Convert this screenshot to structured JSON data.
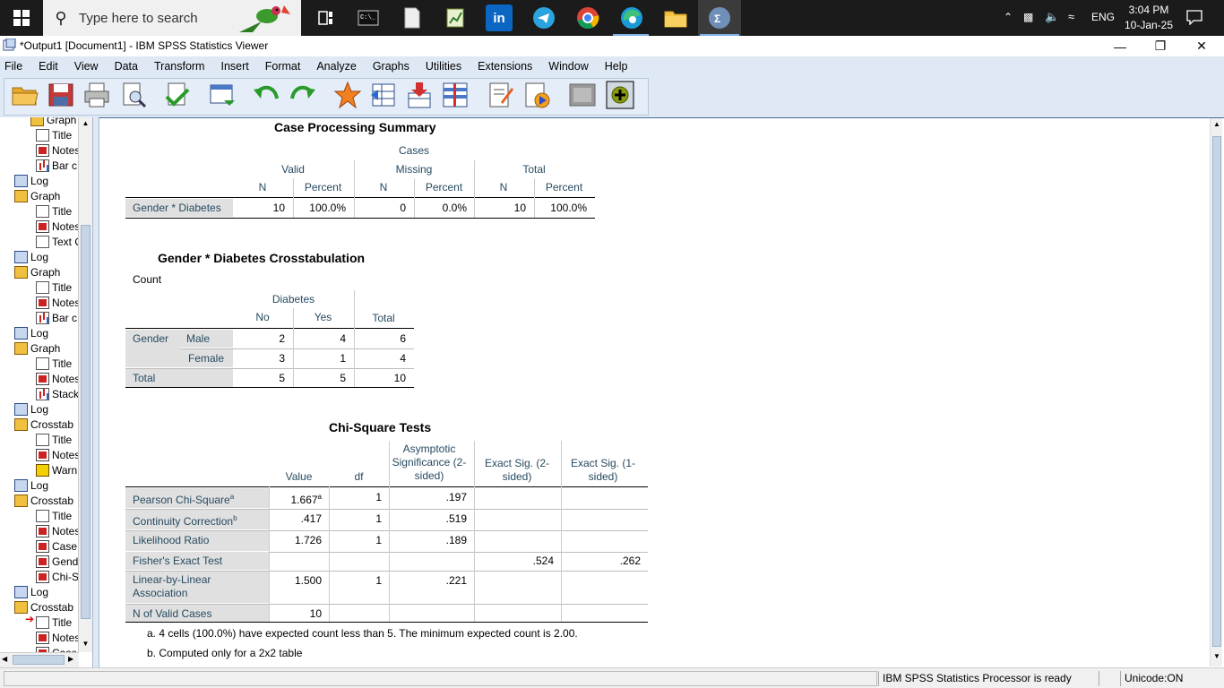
{
  "taskbar": {
    "search_placeholder": "Type here to search",
    "clock_time": "3:04 PM",
    "clock_date": "10-Jan-25",
    "lang": "ENG"
  },
  "window": {
    "title": "*Output1 [Document1] - IBM SPSS Statistics Viewer",
    "minimize": "—",
    "maximize": "❐",
    "close": "✕"
  },
  "menu": [
    "File",
    "Edit",
    "View",
    "Data",
    "Transform",
    "Insert",
    "Format",
    "Analyze",
    "Graphs",
    "Utilities",
    "Extensions",
    "Window",
    "Help"
  ],
  "outline": [
    {
      "indent": 34,
      "icon": "graph",
      "label": "Graph"
    },
    {
      "indent": 40,
      "icon": "title",
      "label": "Title"
    },
    {
      "indent": 40,
      "icon": "note",
      "label": "Notes"
    },
    {
      "indent": 40,
      "icon": "bar",
      "label": "Bar c"
    },
    {
      "indent": 16,
      "icon": "log",
      "label": "Log"
    },
    {
      "indent": 16,
      "icon": "graph",
      "label": "Graph"
    },
    {
      "indent": 40,
      "icon": "title",
      "label": "Title"
    },
    {
      "indent": 40,
      "icon": "note",
      "label": "Notes"
    },
    {
      "indent": 40,
      "icon": "text",
      "label": "Text O"
    },
    {
      "indent": 16,
      "icon": "log",
      "label": "Log"
    },
    {
      "indent": 16,
      "icon": "graph",
      "label": "Graph"
    },
    {
      "indent": 40,
      "icon": "title",
      "label": "Title"
    },
    {
      "indent": 40,
      "icon": "note",
      "label": "Notes"
    },
    {
      "indent": 40,
      "icon": "bar",
      "label": "Bar c"
    },
    {
      "indent": 16,
      "icon": "log",
      "label": "Log"
    },
    {
      "indent": 16,
      "icon": "graph",
      "label": "Graph"
    },
    {
      "indent": 40,
      "icon": "title",
      "label": "Title"
    },
    {
      "indent": 40,
      "icon": "note",
      "label": "Notes"
    },
    {
      "indent": 40,
      "icon": "bar",
      "label": "Stack"
    },
    {
      "indent": 16,
      "icon": "log",
      "label": "Log"
    },
    {
      "indent": 16,
      "icon": "graph",
      "label": "Crosstab"
    },
    {
      "indent": 40,
      "icon": "title",
      "label": "Title"
    },
    {
      "indent": 40,
      "icon": "note",
      "label": "Notes"
    },
    {
      "indent": 40,
      "icon": "warn",
      "label": "Warn"
    },
    {
      "indent": 16,
      "icon": "log",
      "label": "Log"
    },
    {
      "indent": 16,
      "icon": "graph",
      "label": "Crosstab"
    },
    {
      "indent": 40,
      "icon": "title",
      "label": "Title"
    },
    {
      "indent": 40,
      "icon": "note",
      "label": "Notes"
    },
    {
      "indent": 40,
      "icon": "note",
      "label": "Case"
    },
    {
      "indent": 40,
      "icon": "note",
      "label": "Gend"
    },
    {
      "indent": 40,
      "icon": "note",
      "label": "Chi-S"
    },
    {
      "indent": 16,
      "icon": "log",
      "label": "Log"
    },
    {
      "indent": 16,
      "icon": "graph",
      "label": "Crosstab"
    },
    {
      "indent": 40,
      "icon": "title",
      "label": "Title"
    },
    {
      "indent": 40,
      "icon": "note",
      "label": "Notes"
    },
    {
      "indent": 40,
      "icon": "note",
      "label": "Case"
    }
  ],
  "case_summary": {
    "title": "Case Processing Summary",
    "cases": "Cases",
    "groups": [
      "Valid",
      "Missing",
      "Total"
    ],
    "sub": [
      "N",
      "Percent",
      "N",
      "Percent",
      "N",
      "Percent"
    ],
    "row_label": "Gender * Diabetes",
    "values": [
      "10",
      "100.0%",
      "0",
      "0.0%",
      "10",
      "100.0%"
    ]
  },
  "crosstab": {
    "title": "Gender * Diabetes Crosstabulation",
    "count": "Count",
    "diabetes": "Diabetes",
    "cols": [
      "No",
      "Yes",
      "Total"
    ],
    "gender": "Gender",
    "rows": [
      {
        "label": "Male",
        "values": [
          "2",
          "4",
          "6"
        ]
      },
      {
        "label": "Female",
        "values": [
          "3",
          "1",
          "4"
        ]
      }
    ],
    "total_label": "Total",
    "total_values": [
      "5",
      "5",
      "10"
    ]
  },
  "chisq": {
    "title": "Chi-Square Tests",
    "cols": [
      "Value",
      "df",
      "Asymptotic Significance (2-sided)",
      "Exact Sig. (2-sided)",
      "Exact Sig. (1-sided)"
    ],
    "rows": [
      {
        "label": "Pearson Chi-Square",
        "sup": "a",
        "value": "1.667",
        "df": "1",
        "asym": ".197",
        "ex2": "",
        "ex1": ""
      },
      {
        "label": "Continuity Correction",
        "sup": "b",
        "value": ".417",
        "df": "1",
        "asym": ".519",
        "ex2": "",
        "ex1": ""
      },
      {
        "label": "Likelihood Ratio",
        "sup": "",
        "value": "1.726",
        "df": "1",
        "asym": ".189",
        "ex2": "",
        "ex1": ""
      },
      {
        "label": "Fisher's Exact Test",
        "sup": "",
        "value": "",
        "df": "",
        "asym": "",
        "ex2": ".524",
        "ex1": ".262"
      },
      {
        "label": "Linear-by-Linear Association",
        "sup": "",
        "value": "1.500",
        "df": "1",
        "asym": ".221",
        "ex2": "",
        "ex1": ""
      },
      {
        "label": "N of Valid Cases",
        "sup": "",
        "value": "10",
        "df": "",
        "asym": "",
        "ex2": "",
        "ex1": ""
      }
    ],
    "foot_a": "a. 4 cells (100.0%) have expected count less than 5. The minimum expected count is 2.00.",
    "foot_b": "b. Computed only for a 2x2 table"
  },
  "status": {
    "processor": "IBM SPSS Statistics Processor is ready",
    "unicode": "Unicode:ON"
  }
}
